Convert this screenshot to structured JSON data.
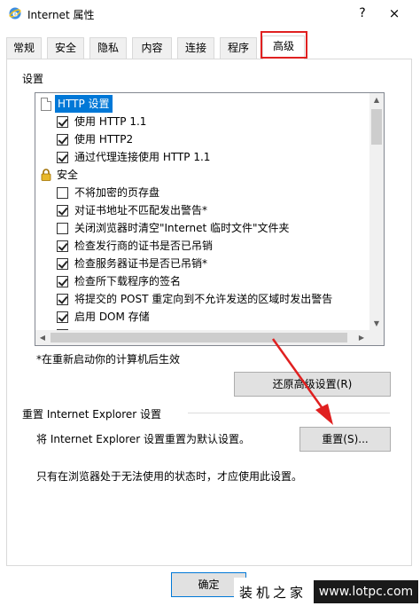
{
  "window": {
    "title": "Internet 属性",
    "help_glyph": "?",
    "close_glyph": "×"
  },
  "tabs": [
    {
      "label": "常规"
    },
    {
      "label": "安全"
    },
    {
      "label": "隐私"
    },
    {
      "label": "内容"
    },
    {
      "label": "连接"
    },
    {
      "label": "程序"
    },
    {
      "label": "高级",
      "active": true
    }
  ],
  "settings": {
    "group_label": "设置",
    "items": [
      {
        "type": "header",
        "icon": "document-icon",
        "label": "HTTP 设置",
        "selected": true
      },
      {
        "type": "checkbox",
        "checked": true,
        "label": "使用 HTTP 1.1"
      },
      {
        "type": "checkbox",
        "checked": true,
        "label": "使用 HTTP2"
      },
      {
        "type": "checkbox",
        "checked": true,
        "label": "通过代理连接使用 HTTP 1.1"
      },
      {
        "type": "header",
        "icon": "lock-icon",
        "label": "安全"
      },
      {
        "type": "checkbox",
        "checked": false,
        "label": "不将加密的页存盘"
      },
      {
        "type": "checkbox",
        "checked": true,
        "label": "对证书地址不匹配发出警告*"
      },
      {
        "type": "checkbox",
        "checked": false,
        "label": "关闭浏览器时清空\"Internet 临时文件\"文件夹"
      },
      {
        "type": "checkbox",
        "checked": true,
        "label": "检查发行商的证书是否已吊销"
      },
      {
        "type": "checkbox",
        "checked": true,
        "label": "检查服务器证书是否已吊销*"
      },
      {
        "type": "checkbox",
        "checked": true,
        "label": "检查所下载程序的签名"
      },
      {
        "type": "checkbox",
        "checked": true,
        "label": "将提交的 POST 重定向到不允许发送的区域时发出警告"
      },
      {
        "type": "checkbox",
        "checked": true,
        "label": "启用 DOM 存储"
      }
    ],
    "restart_note": "*在重新启动你的计算机后生效",
    "restore_button": "还原高级设置(R)"
  },
  "reset": {
    "group_label": "重置 Internet Explorer 设置",
    "description": "将 Internet Explorer 设置重置为默认设置。",
    "button": "重置(S)...",
    "warning": "只有在浏览器处于无法使用的状态时，才应使用此设置。"
  },
  "footer": {
    "ok_button": "确定"
  },
  "watermark": {
    "left": "装机之家",
    "right": "www.lotpc.com"
  },
  "colors": {
    "selection": "#0078d7",
    "annotation": "#e02020"
  }
}
